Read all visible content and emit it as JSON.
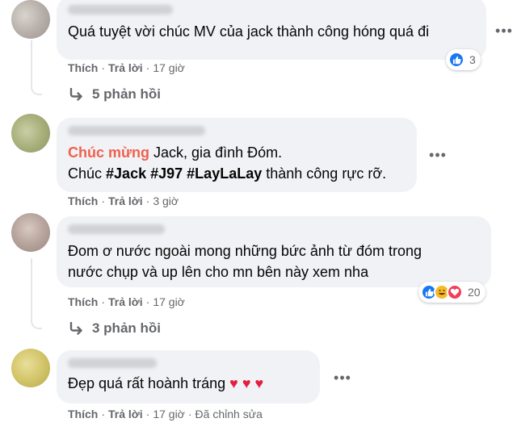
{
  "comments": [
    {
      "text": "Quá tuyệt vời chúc MV của jack thành công hóng quá đi",
      "actions": {
        "like": "Thích",
        "reply": "Trả lời",
        "time": "17 giờ"
      },
      "reaction_count": "3",
      "replies_label": "5 phản hồi"
    },
    {
      "line1_highlight": "Chúc mừng",
      "line1_rest": " Jack, gia đình Đóm.",
      "line2_prefix": "Chúc ",
      "tag1": "#Jack",
      "tag2": "#J97",
      "tag3": "#LayLaLay",
      "line2_suffix": " thành công rực rỡ.",
      "actions": {
        "like": "Thích",
        "reply": "Trả lời",
        "time": "3 giờ"
      }
    },
    {
      "line1": "Đom ơ nước ngoài mong những bức ảnh từ đóm trong",
      "line2": "nước chụp và up lên cho mn bên này xem nha",
      "actions": {
        "like": "Thích",
        "reply": "Trả lời",
        "time": "17 giờ"
      },
      "reaction_count": "20",
      "replies_label": "3 phản hồi"
    },
    {
      "text": "Đẹp quá rất hoành tráng",
      "hearts": "♥ ♥ ♥",
      "actions": {
        "like": "Thích",
        "reply": "Trả lời",
        "time": "17 giờ",
        "edited": "Đã chỉnh sửa"
      }
    }
  ],
  "icons": {
    "more": "more-options-icon",
    "reply_arrow": "reply-arrow-icon",
    "like": "like-reaction-icon",
    "haha": "haha-reaction-icon",
    "love": "love-reaction-icon"
  },
  "colors": {
    "bubble": "#f0f2f5",
    "meta": "#65676b",
    "highlight": "#f0614f",
    "like": "#1877f2",
    "love": "#f33e58",
    "heart": "#e41e3f"
  }
}
